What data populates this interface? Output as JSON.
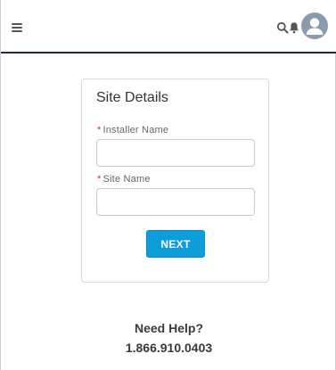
{
  "header": {
    "menu_icon": "hamburger-icon",
    "search_icon": "search-icon",
    "notifications_icon": "bell-icon",
    "avatar_icon": "user-avatar-icon"
  },
  "form": {
    "title": "Site Details",
    "required_marker": "*",
    "fields": [
      {
        "label": "Installer Name",
        "value": "",
        "required": true
      },
      {
        "label": "Site Name",
        "value": "",
        "required": true
      }
    ],
    "next_label": "NEXT",
    "next_color": "#0d9ddb"
  },
  "help": {
    "title": "Need Help?",
    "phone": "1.866.910.0403"
  }
}
